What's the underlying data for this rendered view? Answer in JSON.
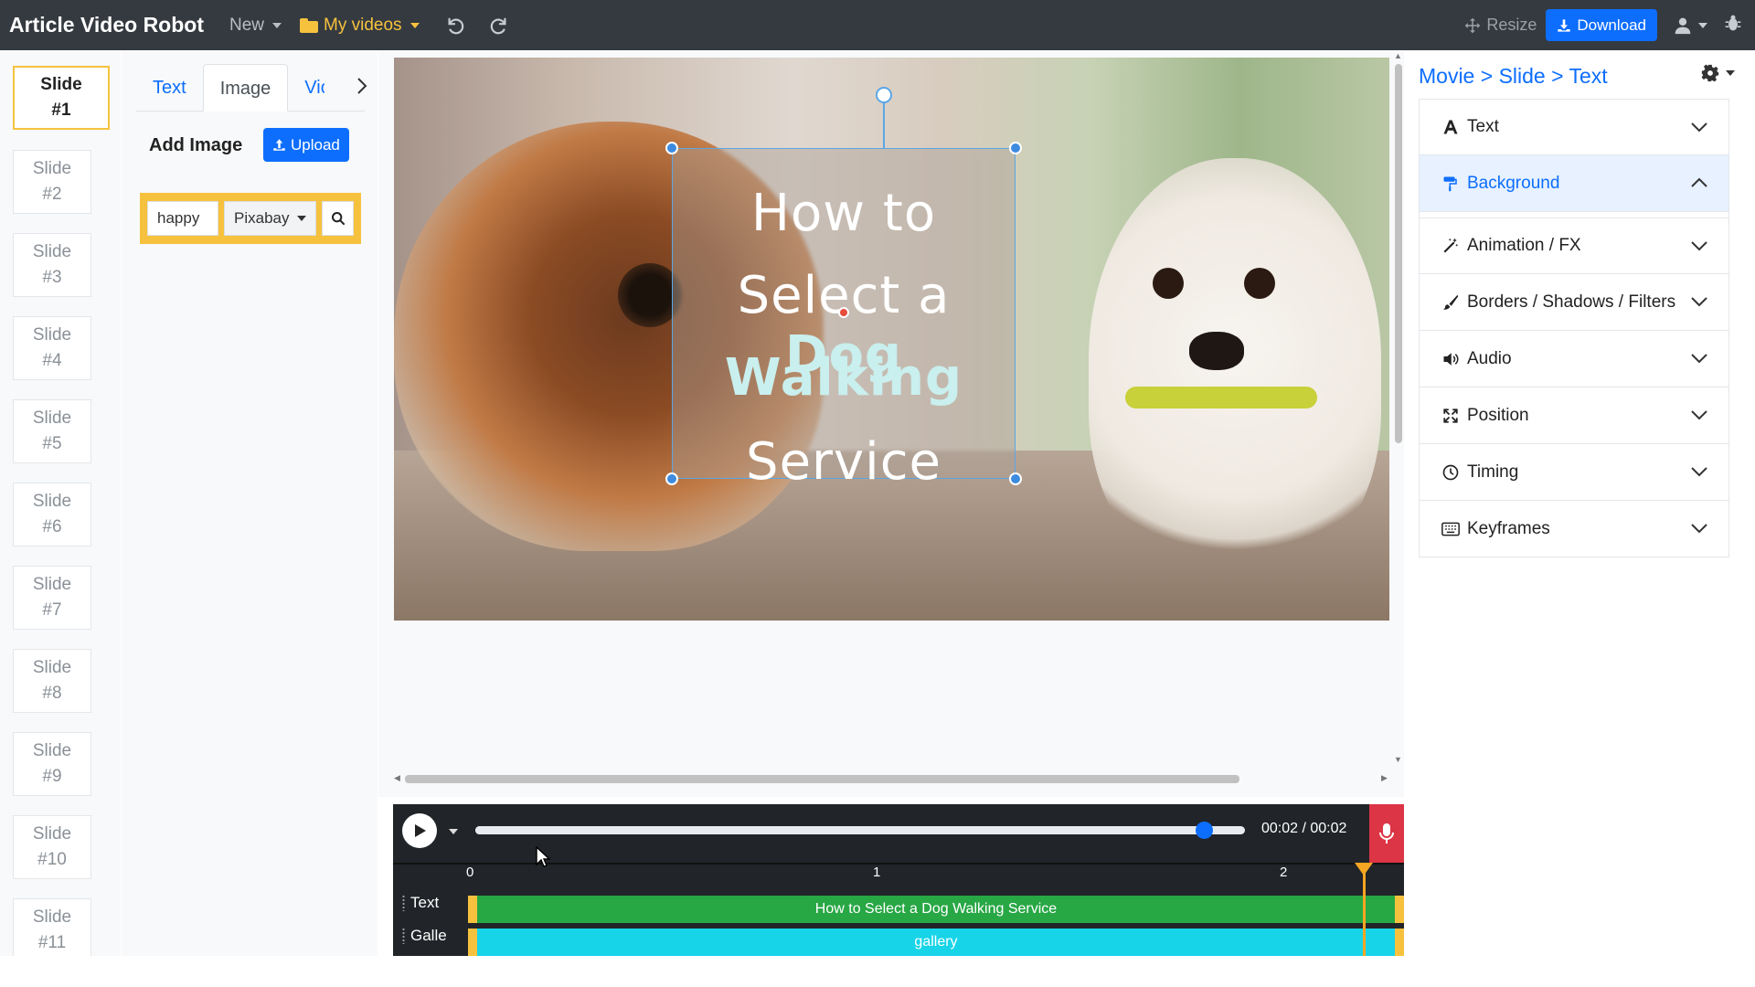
{
  "app": {
    "brand": "Article Video Robot",
    "nav": {
      "new_label": "New",
      "myvideos_label": "My videos",
      "resize_label": "Resize",
      "download_label": "Download"
    }
  },
  "slides": [
    "Slide #1",
    "Slide #2",
    "Slide #3",
    "Slide #4",
    "Slide #5",
    "Slide #6",
    "Slide #7",
    "Slide #8",
    "Slide #9",
    "Slide #10",
    "Slide #11"
  ],
  "addpanel": {
    "tabs": [
      "Text",
      "Image",
      "Vic"
    ],
    "active_tab": "Image",
    "title": "Add Image",
    "upload_label": "Upload",
    "search_value": "happy",
    "source_label": "Pixabay"
  },
  "canvas": {
    "lines": [
      "How to",
      "Select a ",
      "Dog",
      "Walking",
      "Service"
    ]
  },
  "timeline": {
    "time_readout": "00:02 / 00:02",
    "progress_fraction": 0.946,
    "ticks": [
      "0",
      "1",
      "2"
    ],
    "tracks": [
      {
        "label": "Text",
        "bar_text": "How to Select a Dog Walking Service",
        "color": "#28a745"
      },
      {
        "label": "Galle",
        "bar_text": "gallery",
        "color": "#17d4e8"
      }
    ]
  },
  "props": {
    "breadcrumb": "Movie > Slide > Text",
    "sections": [
      "Text",
      "Background",
      "Animation / FX",
      "Borders / Shadows / Filters",
      "Audio",
      "Position",
      "Timing",
      "Keyframes"
    ],
    "open_section": "Background"
  },
  "colors": {
    "navbar": "#343a40",
    "primary": "#0d6efd",
    "accent": "#f6c23e",
    "danger": "#dc3545"
  }
}
